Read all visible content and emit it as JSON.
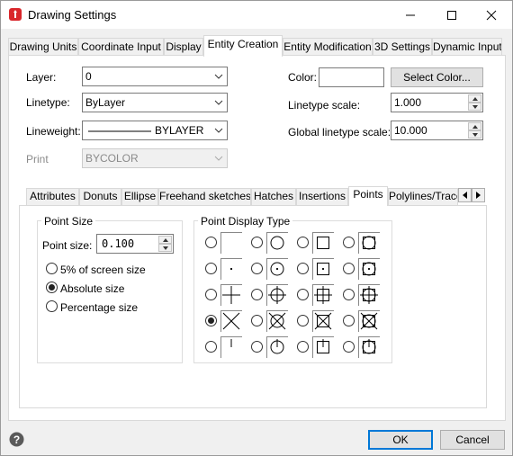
{
  "window": {
    "title": "Drawing Settings"
  },
  "tabs": [
    {
      "label": "Drawing Units"
    },
    {
      "label": "Coordinate Input"
    },
    {
      "label": "Display"
    },
    {
      "label": "Entity Creation"
    },
    {
      "label": "Entity Modification"
    },
    {
      "label": "3D Settings"
    },
    {
      "label": "Dynamic Input"
    }
  ],
  "entity": {
    "layer_label": "Layer:",
    "layer_value": "0",
    "linetype_label": "Linetype:",
    "linetype_value": "ByLayer",
    "lineweight_label": "Lineweight:",
    "lineweight_value": "BYLAYER",
    "print_label": "Print",
    "print_value": "BYCOLOR",
    "color_label": "Color:",
    "select_color_button": "Select Color...",
    "linetype_scale_label": "Linetype scale:",
    "linetype_scale_value": "1.000",
    "global_scale_label": "Global linetype scale:",
    "global_scale_value": "10.000"
  },
  "subtabs": [
    {
      "label": "Attributes"
    },
    {
      "label": "Donuts"
    },
    {
      "label": "Ellipse"
    },
    {
      "label": "Freehand sketches"
    },
    {
      "label": "Hatches"
    },
    {
      "label": "Insertions"
    },
    {
      "label": "Points"
    },
    {
      "label": "Polylines/Traces"
    }
  ],
  "point_size": {
    "group_title": "Point Size",
    "size_label": "Point size:",
    "size_value": "0.100",
    "options": [
      {
        "label": "5% of screen size",
        "selected": false
      },
      {
        "label": "Absolute size",
        "selected": true
      },
      {
        "label": "Percentage size",
        "selected": false
      }
    ]
  },
  "point_display": {
    "group_title": "Point Display Type",
    "selected_index": 12
  },
  "footer": {
    "ok_button": "OK",
    "cancel_button": "Cancel"
  },
  "colors": {
    "accent": "#0078d7",
    "title_icon": "#d9262b"
  }
}
